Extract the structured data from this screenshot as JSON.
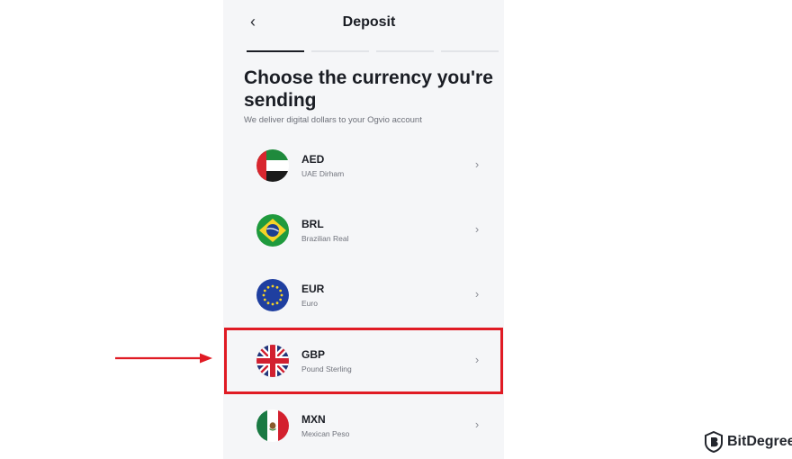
{
  "header": {
    "title": "Deposit",
    "back_label": "‹"
  },
  "heading": "Choose the currency you're sending",
  "subtext": "We deliver digital dollars to your Ogvio account",
  "steps": {
    "total": 4,
    "active": 1
  },
  "currencies": [
    {
      "code": "AED",
      "name": "UAE Dirham",
      "flag": "uae-flag-icon"
    },
    {
      "code": "BRL",
      "name": "Brazilian Real",
      "flag": "brazil-flag-icon"
    },
    {
      "code": "EUR",
      "name": "Euro",
      "flag": "eu-flag-icon"
    },
    {
      "code": "GBP",
      "name": "Pound Sterling",
      "flag": "uk-flag-icon"
    },
    {
      "code": "MXN",
      "name": "Mexican Peso",
      "flag": "mexico-flag-icon"
    }
  ],
  "highlighted_currency": "GBP",
  "colors": {
    "highlight": "#e01b24",
    "arrow": "#e01b24",
    "text": "#1a1d24",
    "panel": "#f5f6f8"
  },
  "watermark": {
    "text": "BitDegree",
    "icon": "bitdegree-logo-icon"
  }
}
